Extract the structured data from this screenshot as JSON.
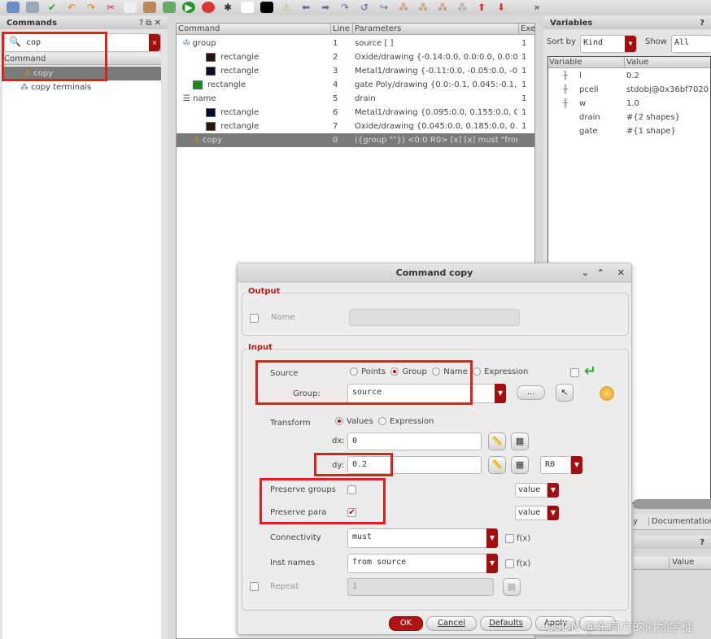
{
  "commands_panel": {
    "title": "Commands",
    "search_value": "cop",
    "column": "Command",
    "items": [
      "copy",
      "copy terminals"
    ]
  },
  "command_table": {
    "columns": [
      "Command",
      "Line",
      "Parameters",
      "Exe"
    ],
    "rows": [
      {
        "command": "group",
        "line": "1",
        "params": "source [ ]",
        "exe": "1"
      },
      {
        "command": "rectangle",
        "line": "2",
        "params": "Oxide/drawing {-0.14:0.0, 0.0:0.0, 0.0:0....",
        "exe": "1"
      },
      {
        "command": "rectangle",
        "line": "3",
        "params": "Metal1/drawing {-0.11:0.0, -0.05:0.0, -0....",
        "exe": "1"
      },
      {
        "command": "rectangle",
        "line": "4",
        "params": "gate Poly/drawing {0.0:-0.1, 0.045:-0.1, ...",
        "exe": "1"
      },
      {
        "command": "name",
        "line": "5",
        "params": "drain",
        "exe": "1"
      },
      {
        "command": "rectangle",
        "line": "6",
        "params": "Metal1/drawing {0.095:0.0, 0.155:0.0, 0....",
        "exe": "1"
      },
      {
        "command": "rectangle",
        "line": "7",
        "params": "Oxide/drawing {0.045:0.0, 0.185:0.0, 0....",
        "exe": "1"
      },
      {
        "command": "copy",
        "line": "0",
        "params": "({group \"\"}) <0:0 R0> [x] [x] must \"from...",
        "exe": ""
      }
    ]
  },
  "variables_panel": {
    "title": "Variables",
    "sort_by_label": "Sort by",
    "sort_by_value": "Kind",
    "show_label": "Show",
    "show_value": "All",
    "columns": [
      "Variable",
      "Value"
    ],
    "rows": [
      {
        "name": "l",
        "value": "0.2"
      },
      {
        "name": "pcell",
        "value": "stdobj@0x36bf7020"
      },
      {
        "name": "w",
        "value": "1.0"
      },
      {
        "name": "drain",
        "value": "#{2 shapes}"
      },
      {
        "name": "gate",
        "value": "#{1 shape}"
      }
    ]
  },
  "lower_panel": {
    "tab_partial": "y",
    "tab_documentation": "Documentation",
    "help": "?",
    "column_value": "Value"
  },
  "dialog": {
    "title": "Command copy",
    "output": {
      "legend": "Output",
      "name_label": "Name",
      "name_value": ""
    },
    "input": {
      "legend": "Input",
      "source_label": "Source",
      "source_options": [
        "Points",
        "Group",
        "Name",
        "Expression"
      ],
      "source_selected": "Group",
      "group_label": "Group:",
      "group_value": "source",
      "browse": "...",
      "transform_label": "Transform",
      "transform_options": [
        "Values",
        "Expression"
      ],
      "transform_selected": "Values",
      "dx_label": "dx:",
      "dx_value": "0",
      "dy_label": "dy:",
      "dy_value": "0.2",
      "rotation": "R0",
      "preserve_groups_label": "Preserve groups",
      "preserve_groups": false,
      "preserve_groups_mode": "value",
      "preserve_para_label": "Preserve para",
      "preserve_para": true,
      "preserve_para_mode": "value",
      "connectivity_label": "Connectivity",
      "connectivity_value": "must",
      "fx": "f(x)",
      "inst_names_label": "Inst names",
      "inst_names_value": "from source",
      "repeat_label": "Repeat",
      "repeat_value": "1"
    },
    "buttons": {
      "ok": "OK",
      "cancel": "Cancel",
      "defaults": "Defaults",
      "apply": "Apply"
    }
  },
  "watermark": "CSDN @东南方的射频学徒",
  "colors": {
    "accent_red": "#a40d0d",
    "highlight_box": "#e02020",
    "selection": "#7a7a7a"
  }
}
